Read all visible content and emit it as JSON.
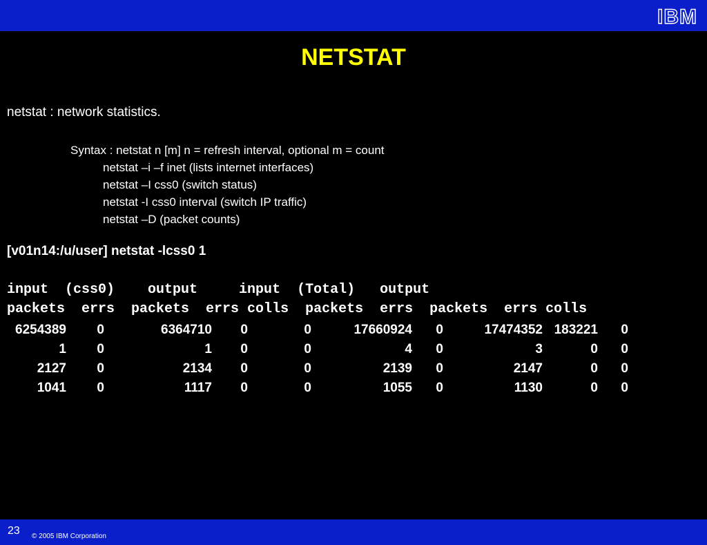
{
  "header": {
    "logo_text": "IBM"
  },
  "slide": {
    "title": "NETSTAT",
    "intro": "netstat : network statistics.",
    "syntax": {
      "line0": "Syntax : netstat n [m] n = refresh interval, optional m = count",
      "line1": "netstat –i –f inet (lists internet interfaces)",
      "line2": "netstat –I css0 (switch status)",
      "line3": "netstat -I css0 interval (switch IP traffic)",
      "line4": "netstat –D (packet counts)"
    },
    "command": "[v01n14:/u/user] netstat -lcss0 1",
    "header_row1": "input  (css0)    output     input  (Total)   output",
    "header_row2": "packets  errs  packets  errs colls  packets  errs  packets  errs colls",
    "rows": [
      [
        "6254389",
        "0",
        "6364710",
        "0",
        "0",
        "17660924",
        "0",
        "17474352",
        "183221",
        "0"
      ],
      [
        "1",
        "0",
        "1",
        "0",
        "0",
        "4",
        "0",
        "3",
        "0",
        "0"
      ],
      [
        "2127",
        "0",
        "2134",
        "0",
        "0",
        "2139",
        "0",
        "2147",
        "0",
        "0"
      ],
      [
        "1041",
        "0",
        "1117",
        "0",
        "0",
        "1055",
        "0",
        "1130",
        "0",
        "0"
      ]
    ]
  },
  "footer": {
    "page_number": "23",
    "copyright": "© 2005 IBM Corporation"
  },
  "colors": {
    "bar": "#0a1fc9",
    "title": "#ffff00",
    "background": "#000000"
  }
}
